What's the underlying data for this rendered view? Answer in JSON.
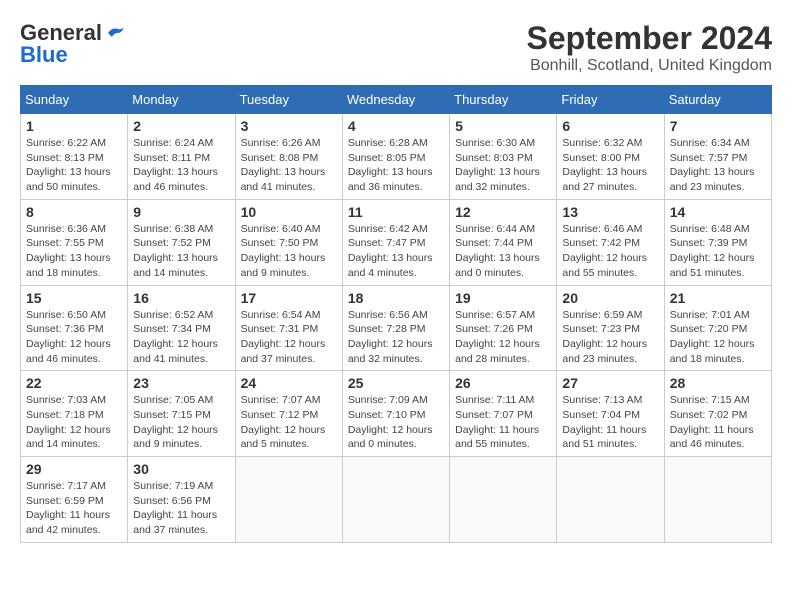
{
  "header": {
    "logo_line1": "General",
    "logo_line2": "Blue",
    "title": "September 2024",
    "subtitle": "Bonhill, Scotland, United Kingdom"
  },
  "calendar": {
    "days_of_week": [
      "Sunday",
      "Monday",
      "Tuesday",
      "Wednesday",
      "Thursday",
      "Friday",
      "Saturday"
    ],
    "weeks": [
      [
        {
          "day": "",
          "empty": true
        },
        {
          "day": "",
          "empty": true
        },
        {
          "day": "",
          "empty": true
        },
        {
          "day": "",
          "empty": true
        },
        {
          "day": "",
          "empty": true
        },
        {
          "day": "",
          "empty": true
        },
        {
          "day": "",
          "empty": true
        }
      ],
      [
        {
          "day": "1",
          "sunrise": "6:22 AM",
          "sunset": "8:13 PM",
          "daylight": "13 hours and 50 minutes."
        },
        {
          "day": "2",
          "sunrise": "6:24 AM",
          "sunset": "8:11 PM",
          "daylight": "13 hours and 46 minutes."
        },
        {
          "day": "3",
          "sunrise": "6:26 AM",
          "sunset": "8:08 PM",
          "daylight": "13 hours and 41 minutes."
        },
        {
          "day": "4",
          "sunrise": "6:28 AM",
          "sunset": "8:05 PM",
          "daylight": "13 hours and 36 minutes."
        },
        {
          "day": "5",
          "sunrise": "6:30 AM",
          "sunset": "8:03 PM",
          "daylight": "13 hours and 32 minutes."
        },
        {
          "day": "6",
          "sunrise": "6:32 AM",
          "sunset": "8:00 PM",
          "daylight": "13 hours and 27 minutes."
        },
        {
          "day": "7",
          "sunrise": "6:34 AM",
          "sunset": "7:57 PM",
          "daylight": "13 hours and 23 minutes."
        }
      ],
      [
        {
          "day": "8",
          "sunrise": "6:36 AM",
          "sunset": "7:55 PM",
          "daylight": "13 hours and 18 minutes."
        },
        {
          "day": "9",
          "sunrise": "6:38 AM",
          "sunset": "7:52 PM",
          "daylight": "13 hours and 14 minutes."
        },
        {
          "day": "10",
          "sunrise": "6:40 AM",
          "sunset": "7:50 PM",
          "daylight": "13 hours and 9 minutes."
        },
        {
          "day": "11",
          "sunrise": "6:42 AM",
          "sunset": "7:47 PM",
          "daylight": "13 hours and 4 minutes."
        },
        {
          "day": "12",
          "sunrise": "6:44 AM",
          "sunset": "7:44 PM",
          "daylight": "13 hours and 0 minutes."
        },
        {
          "day": "13",
          "sunrise": "6:46 AM",
          "sunset": "7:42 PM",
          "daylight": "12 hours and 55 minutes."
        },
        {
          "day": "14",
          "sunrise": "6:48 AM",
          "sunset": "7:39 PM",
          "daylight": "12 hours and 51 minutes."
        }
      ],
      [
        {
          "day": "15",
          "sunrise": "6:50 AM",
          "sunset": "7:36 PM",
          "daylight": "12 hours and 46 minutes."
        },
        {
          "day": "16",
          "sunrise": "6:52 AM",
          "sunset": "7:34 PM",
          "daylight": "12 hours and 41 minutes."
        },
        {
          "day": "17",
          "sunrise": "6:54 AM",
          "sunset": "7:31 PM",
          "daylight": "12 hours and 37 minutes."
        },
        {
          "day": "18",
          "sunrise": "6:56 AM",
          "sunset": "7:28 PM",
          "daylight": "12 hours and 32 minutes."
        },
        {
          "day": "19",
          "sunrise": "6:57 AM",
          "sunset": "7:26 PM",
          "daylight": "12 hours and 28 minutes."
        },
        {
          "day": "20",
          "sunrise": "6:59 AM",
          "sunset": "7:23 PM",
          "daylight": "12 hours and 23 minutes."
        },
        {
          "day": "21",
          "sunrise": "7:01 AM",
          "sunset": "7:20 PM",
          "daylight": "12 hours and 18 minutes."
        }
      ],
      [
        {
          "day": "22",
          "sunrise": "7:03 AM",
          "sunset": "7:18 PM",
          "daylight": "12 hours and 14 minutes."
        },
        {
          "day": "23",
          "sunrise": "7:05 AM",
          "sunset": "7:15 PM",
          "daylight": "12 hours and 9 minutes."
        },
        {
          "day": "24",
          "sunrise": "7:07 AM",
          "sunset": "7:12 PM",
          "daylight": "12 hours and 5 minutes."
        },
        {
          "day": "25",
          "sunrise": "7:09 AM",
          "sunset": "7:10 PM",
          "daylight": "12 hours and 0 minutes."
        },
        {
          "day": "26",
          "sunrise": "7:11 AM",
          "sunset": "7:07 PM",
          "daylight": "11 hours and 55 minutes."
        },
        {
          "day": "27",
          "sunrise": "7:13 AM",
          "sunset": "7:04 PM",
          "daylight": "11 hours and 51 minutes."
        },
        {
          "day": "28",
          "sunrise": "7:15 AM",
          "sunset": "7:02 PM",
          "daylight": "11 hours and 46 minutes."
        }
      ],
      [
        {
          "day": "29",
          "sunrise": "7:17 AM",
          "sunset": "6:59 PM",
          "daylight": "11 hours and 42 minutes."
        },
        {
          "day": "30",
          "sunrise": "7:19 AM",
          "sunset": "6:56 PM",
          "daylight": "11 hours and 37 minutes."
        },
        {
          "day": "",
          "empty": true
        },
        {
          "day": "",
          "empty": true
        },
        {
          "day": "",
          "empty": true
        },
        {
          "day": "",
          "empty": true
        },
        {
          "day": "",
          "empty": true
        }
      ]
    ]
  }
}
